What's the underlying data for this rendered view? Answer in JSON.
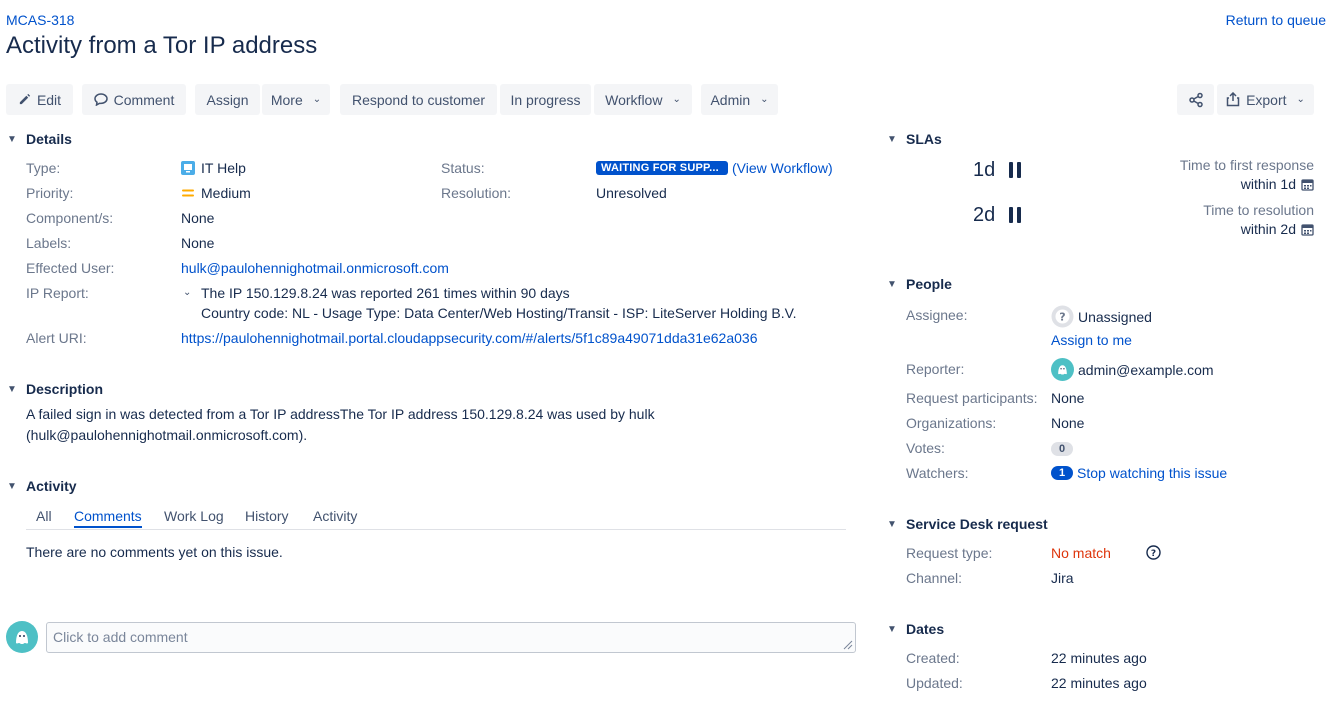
{
  "header": {
    "issue_key": "MCAS-318",
    "title": "Activity from a Tor IP address",
    "return_link": "Return to queue"
  },
  "toolbar": {
    "edit": "Edit",
    "comment": "Comment",
    "assign": "Assign",
    "more": "More",
    "respond": "Respond to customer",
    "in_progress": "In progress",
    "workflow": "Workflow",
    "admin": "Admin",
    "export": "Export"
  },
  "details": {
    "heading": "Details",
    "type_label": "Type:",
    "type_value": "IT Help",
    "priority_label": "Priority:",
    "priority_value": "Medium",
    "components_label": "Component/s:",
    "components_value": "None",
    "labels_label": "Labels:",
    "labels_value": "None",
    "effected_user_label": "Effected User:",
    "effected_user_value": "hulk@paulohennighotmail.onmicrosoft.com",
    "ip_report_label": "IP Report:",
    "ip_report_line1": "The IP 150.129.8.24 was reported 261 times within 90 days",
    "ip_report_line2": "Country code: NL - Usage Type: Data Center/Web Hosting/Transit - ISP: LiteServer Holding B.V.",
    "alert_uri_label": "Alert URI:",
    "alert_uri_value": "https://paulohennighotmail.portal.cloudappsecurity.com/#/alerts/5f1c89a49071dda31e62a036",
    "status_label": "Status:",
    "status_value": "WAITING FOR SUPP...",
    "view_workflow": "(View Workflow)",
    "resolution_label": "Resolution:",
    "resolution_value": "Unresolved"
  },
  "description": {
    "heading": "Description",
    "line1": "A failed sign in was detected from a Tor IP addressThe Tor IP address 150.129.8.24 was used by hulk",
    "line2": "(hulk@paulohennighotmail.onmicrosoft.com)."
  },
  "activity": {
    "heading": "Activity",
    "tabs": [
      "All",
      "Comments",
      "Work Log",
      "History",
      "Activity"
    ],
    "active_tab": "Comments",
    "empty_text": "There are no comments yet on this issue.",
    "comment_placeholder": "Click to add comment"
  },
  "slas": {
    "heading": "SLAs",
    "items": [
      {
        "remaining": "1d",
        "name": "Time to first response",
        "goal": "within 1d"
      },
      {
        "remaining": "2d",
        "name": "Time to resolution",
        "goal": "within 2d"
      }
    ]
  },
  "people": {
    "heading": "People",
    "assignee_label": "Assignee:",
    "assignee_value": "Unassigned",
    "assign_to_me": "Assign to me",
    "reporter_label": "Reporter:",
    "reporter_value": "admin@example.com",
    "participants_label": "Request participants:",
    "participants_value": "None",
    "organizations_label": "Organizations:",
    "organizations_value": "None",
    "votes_label": "Votes:",
    "votes_value": "0",
    "watchers_label": "Watchers:",
    "watchers_count": "1",
    "watchers_action": "Stop watching this issue"
  },
  "service_desk": {
    "heading": "Service Desk request",
    "request_type_label": "Request type:",
    "request_type_value": "No match",
    "channel_label": "Channel:",
    "channel_value": "Jira"
  },
  "dates": {
    "heading": "Dates",
    "created_label": "Created:",
    "created_value": "22 minutes ago",
    "updated_label": "Updated:",
    "updated_value": "22 minutes ago"
  },
  "colors": {
    "link": "#0052cc",
    "text": "#172b4d",
    "muted": "#6b778c",
    "button_bg": "#f4f5f7",
    "status_lozenge": "#0052cc",
    "priority_medium": "#ffab00",
    "no_match": "#de350b",
    "avatar": "#4ec0c5"
  },
  "icons": {
    "edit": "pencil-icon",
    "comment": "speech-bubble-icon",
    "share": "share-icon",
    "export": "export-icon",
    "type": "it-help-icon",
    "priority": "priority-medium-icon",
    "sla_status": "pause-icon",
    "calendar": "calendar-icon",
    "help": "question-circle-icon"
  }
}
